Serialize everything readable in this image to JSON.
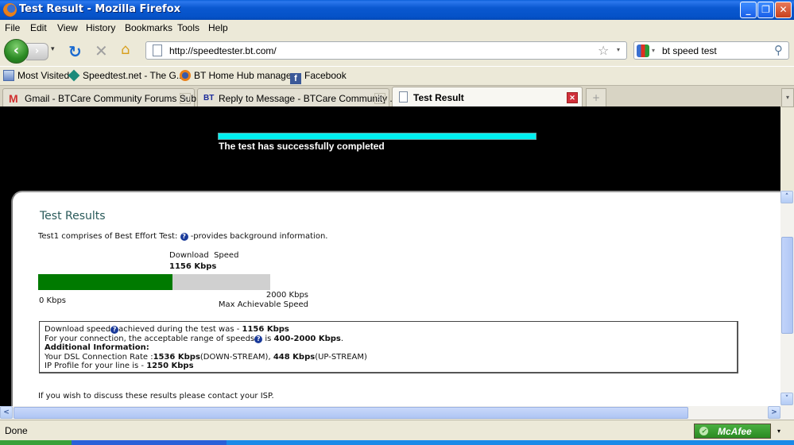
{
  "window": {
    "title": "Test Result - Mozilla Firefox",
    "minimize": "_",
    "maximize": "❐",
    "close": "✕"
  },
  "menu": [
    "File",
    "Edit",
    "View",
    "History",
    "Bookmarks",
    "Tools",
    "Help"
  ],
  "nav": {
    "back_icon": "‹",
    "forward_icon": "›",
    "history_dropdown": "▾",
    "reload_icon": "↻",
    "stop_icon": "✕",
    "home_icon": "⌂",
    "url": "http://speedtester.bt.com/",
    "bookmark_star": "☆",
    "url_dropdown": "▾",
    "search_engine_dropdown": "▾",
    "search_query": "bt speed test",
    "search_icon": "⚲"
  },
  "bookmarks": [
    {
      "label": "Most Visited",
      "icon": "most-visited-icon"
    },
    {
      "label": "Speedtest.net - The G...",
      "icon": "speedtest-icon"
    },
    {
      "label": "BT Home Hub manage...",
      "icon": "bt-hub-icon"
    },
    {
      "label": "Facebook",
      "icon": "facebook-icon"
    }
  ],
  "tabs": [
    {
      "label": "Gmail - BTCare Community Forums Sub...",
      "icon": "gmail-icon",
      "active": false
    },
    {
      "label": "Reply to Message - BTCare Community ...",
      "icon": "bt-icon",
      "active": false
    },
    {
      "label": "Test Result",
      "icon": "page-icon",
      "active": true
    }
  ],
  "tab_close": "✕",
  "new_tab": "+",
  "tab_list": "▾",
  "page": {
    "progress_percent": 100,
    "status_message": "The test has successfully completed",
    "title": "Test Results",
    "intro_prefix": "Test1 comprises of Best Effort Test:",
    "intro_suffix": "-provides background information.",
    "help_glyph": "?",
    "download_label": "Download  Speed",
    "download_value": "1156 Kbps",
    "meter": {
      "value_kbps": 1156,
      "max_kbps": 2000,
      "fill_color": "#007a00"
    },
    "min_label": "0 Kbps",
    "max_label": "2000 Kbps",
    "max_caption": "Max Achievable Speed",
    "info": {
      "line1_prefix": "Download speed",
      "line1_mid": "achieved during the test was - ",
      "line1_value": "1156 Kbps",
      "line2_prefix": "For your connection, the acceptable range of speeds",
      "line2_mid": " is ",
      "line2_value": "400-2000 Kbps",
      "line2_end": ".",
      "heading": "Additional Information:",
      "line4_prefix": "Your DSL Connection Rate :",
      "line4_down": "1536 Kbps",
      "line4_down_label": "(DOWN-STREAM), ",
      "line4_up": "448 Kbps",
      "line4_up_label": "(UP-STREAM)",
      "line5_prefix": "IP Profile for your line is - ",
      "line5_value": "1250 Kbps"
    },
    "contact": "If you wish to discuss these results please contact your ISP."
  },
  "scroll": {
    "up": "˄",
    "down": "˅",
    "left": "<",
    "right": ">"
  },
  "status": {
    "text": "Done",
    "mcafee": "McAfee",
    "mcafee_check": "✓",
    "dropdown": "▾"
  }
}
